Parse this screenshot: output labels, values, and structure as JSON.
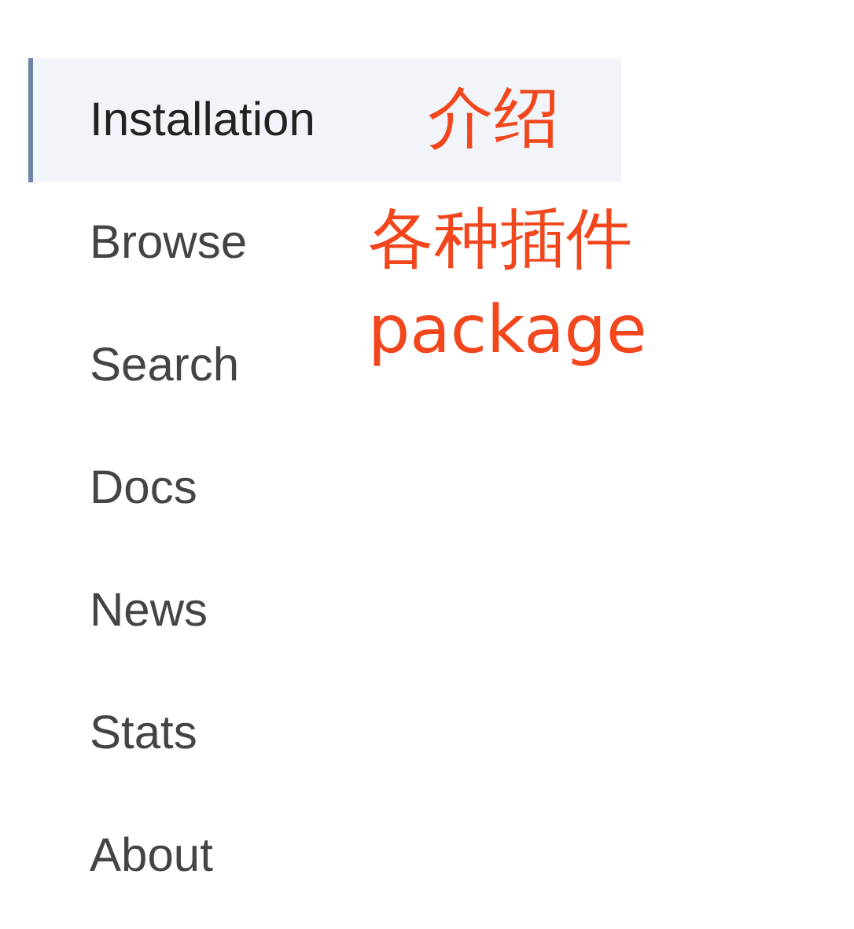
{
  "nav": {
    "items": [
      {
        "label": "Installation",
        "selected": true
      },
      {
        "label": "Browse",
        "selected": false
      },
      {
        "label": "Search",
        "selected": false
      },
      {
        "label": "Docs",
        "selected": false
      },
      {
        "label": "News",
        "selected": false
      },
      {
        "label": "Stats",
        "selected": false
      },
      {
        "label": "About",
        "selected": false
      }
    ]
  },
  "annotations": [
    "介绍",
    "各种插件",
    "package"
  ]
}
